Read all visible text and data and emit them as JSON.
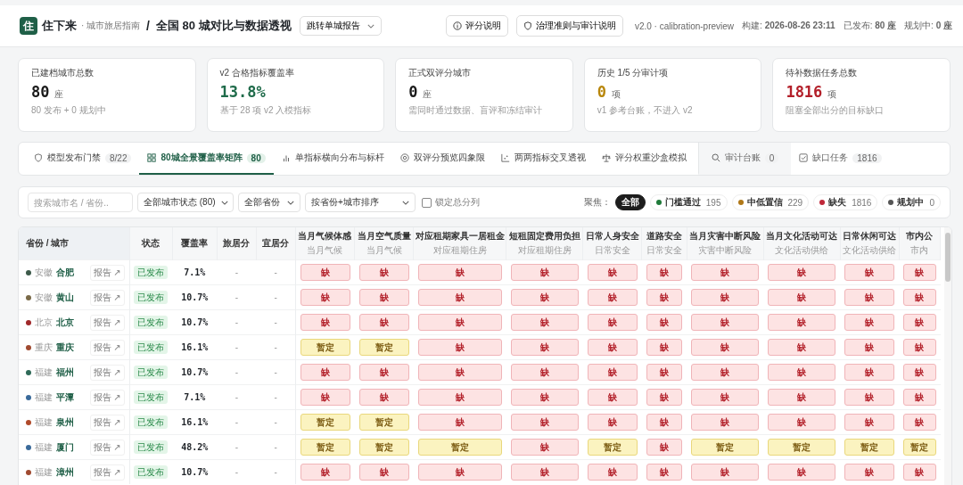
{
  "header": {
    "logo": "住",
    "brand": "住下来",
    "brand_sub": "· 城市旅居指南",
    "separator": "/",
    "title": "全国 80 城对比与数据透视",
    "jump_select": "跳转单城报告",
    "buttons": [
      {
        "label": "评分说明",
        "kind": "info"
      },
      {
        "label": "治理准则与审计说明",
        "kind": "shield"
      }
    ],
    "version": "v2.0 · calibration-preview",
    "build": "构建: **2026-08-26 23:11**",
    "published": "已发布: **80 座**",
    "planned": "规划中: **0 座**"
  },
  "stats": [
    {
      "label": "已建档城市总数",
      "value": "80",
      "unit": "座",
      "note": "80 发布 + 0 规划中",
      "color": "#1a1a1a"
    },
    {
      "label": "v2 合格指标覆盖率",
      "value": "13.8%",
      "note": "基于 28 项 v2 入模指标",
      "color": "#1f6b4a"
    },
    {
      "label": "正式双评分城市",
      "value": "0",
      "unit": "座",
      "note": "需同时通过数据、盲评和冻结审计",
      "color": "#1a1a1a"
    },
    {
      "label": "历史 1/5 分审计项",
      "value": "0",
      "unit": "项",
      "note": "v1 参考台账，不进入 v2",
      "color": "#b8860b"
    },
    {
      "label": "待补数据任务总数",
      "value": "1816",
      "unit": "项",
      "note": "阻塞全部出分的目标缺口",
      "color": "#b3202a"
    }
  ],
  "tabs": [
    {
      "label": "模型发布门禁",
      "count": "8/22",
      "kind": "main",
      "selected": false
    },
    {
      "label": "80城全景覆盖率矩阵",
      "count": "80",
      "kind": "main",
      "selected": true
    },
    {
      "label": "单指标横向分布与标杆",
      "kind": "main",
      "selected": false
    },
    {
      "label": "双评分预览四象限",
      "kind": "main",
      "selected": false
    },
    {
      "label": "两两指标交叉透视",
      "kind": "main",
      "selected": false
    },
    {
      "label": "评分权重沙盒模拟",
      "kind": "main",
      "selected": false
    },
    {
      "label": "审计台账",
      "count": "0",
      "kind": "aux",
      "selected": false
    },
    {
      "label": "缺口任务",
      "count": "1816",
      "kind": "aux",
      "selected": false
    }
  ],
  "filters": {
    "search": {
      "placeholder": "搜索城市名 / 省份.."
    },
    "selects": [
      "全部城市状态 (80)",
      "全部省份",
      "按省份+城市排序"
    ],
    "lock": {
      "label": "锁定总分列",
      "checked": false
    },
    "focus_label": "聚焦：",
    "focus": [
      {
        "label": "全部",
        "selected": true
      },
      {
        "label": "门槛通过",
        "count": "195",
        "color": "#1f7a3a",
        "selected": false
      },
      {
        "label": "中低置信",
        "count": "229",
        "color": "#b07818",
        "selected": false
      },
      {
        "label": "缺失",
        "count": "1816",
        "color": "#c0283a",
        "selected": false
      },
      {
        "label": "规划中",
        "count": "0",
        "color": "#555555",
        "selected": false
      }
    ]
  },
  "table": {
    "columns": [
      "省份 / 城市",
      "状态",
      "覆盖率",
      "旅居分",
      "宜居分"
    ],
    "metrics": [
      {
        "title": "当月气候体感",
        "sub": "当月气候"
      },
      {
        "title": "当月空气质量",
        "sub": "当月气候"
      },
      {
        "title": "对应租期家具一居租金",
        "sub": "对应租期住房"
      },
      {
        "title": "短租固定费用负担",
        "sub": "对应租期住房"
      },
      {
        "title": "日常人身安全",
        "sub": "日常安全"
      },
      {
        "title": "道路安全",
        "sub": "日常安全"
      },
      {
        "title": "当月灾害中断风险",
        "sub": "灾害中断风险"
      },
      {
        "title": "当月文化活动可达",
        "sub": "文化活动供给"
      },
      {
        "title": "日常休闲可达",
        "sub": "文化活动供给"
      },
      {
        "title": "市内公",
        "sub": "市内"
      }
    ],
    "rows": [
      {
        "province": "安徽",
        "city": "合肥",
        "color": "#3d5a4a",
        "report": "报告 ↗",
        "status": "已发布",
        "coverage": "7.1%",
        "travel": "-",
        "live": "-",
        "cells": [
          {
            "kind": "missing",
            "text": "缺"
          },
          {
            "kind": "missing",
            "text": "缺"
          },
          {
            "kind": "missing",
            "text": "缺"
          },
          {
            "kind": "missing",
            "text": "缺"
          },
          {
            "kind": "missing",
            "text": "缺"
          },
          {
            "kind": "missing",
            "text": "缺"
          },
          {
            "kind": "missing",
            "text": "缺"
          },
          {
            "kind": "missing",
            "text": "缺"
          },
          {
            "kind": "missing",
            "text": "缺"
          },
          {
            "kind": "missing",
            "text": "缺"
          }
        ]
      },
      {
        "province": "安徽",
        "city": "黄山",
        "color": "#7a6a48",
        "report": "报告 ↗",
        "status": "已发布",
        "coverage": "10.7%",
        "travel": "-",
        "live": "-",
        "cells": [
          {
            "kind": "missing",
            "text": "缺"
          },
          {
            "kind": "missing",
            "text": "缺"
          },
          {
            "kind": "missing",
            "text": "缺"
          },
          {
            "kind": "missing",
            "text": "缺"
          },
          {
            "kind": "missing",
            "text": "缺"
          },
          {
            "kind": "missing",
            "text": "缺"
          },
          {
            "kind": "missing",
            "text": "缺"
          },
          {
            "kind": "missing",
            "text": "缺"
          },
          {
            "kind": "missing",
            "text": "缺"
          },
          {
            "kind": "missing",
            "text": "缺"
          }
        ]
      },
      {
        "province": "北京",
        "city": "北京",
        "color": "#a0282a",
        "report": "报告 ↗",
        "status": "已发布",
        "coverage": "10.7%",
        "travel": "-",
        "live": "-",
        "cells": [
          {
            "kind": "missing",
            "text": "缺"
          },
          {
            "kind": "missing",
            "text": "缺"
          },
          {
            "kind": "missing",
            "text": "缺"
          },
          {
            "kind": "missing",
            "text": "缺"
          },
          {
            "kind": "missing",
            "text": "缺"
          },
          {
            "kind": "missing",
            "text": "缺"
          },
          {
            "kind": "missing",
            "text": "缺"
          },
          {
            "kind": "missing",
            "text": "缺"
          },
          {
            "kind": "missing",
            "text": "缺"
          },
          {
            "kind": "missing",
            "text": "缺"
          }
        ]
      },
      {
        "province": "重庆",
        "city": "重庆",
        "color": "#a04a30",
        "report": "报告 ↗",
        "status": "已发布",
        "coverage": "16.1%",
        "travel": "-",
        "live": "-",
        "cells": [
          {
            "kind": "tentative",
            "text": "暂定"
          },
          {
            "kind": "tentative",
            "text": "暂定"
          },
          {
            "kind": "missing",
            "text": "缺"
          },
          {
            "kind": "missing",
            "text": "缺"
          },
          {
            "kind": "missing",
            "text": "缺"
          },
          {
            "kind": "missing",
            "text": "缺"
          },
          {
            "kind": "missing",
            "text": "缺"
          },
          {
            "kind": "missing",
            "text": "缺"
          },
          {
            "kind": "missing",
            "text": "缺"
          },
          {
            "kind": "missing",
            "text": "缺"
          }
        ]
      },
      {
        "province": "福建",
        "city": "福州",
        "color": "#2f6a58",
        "report": "报告 ↗",
        "status": "已发布",
        "coverage": "10.7%",
        "travel": "-",
        "live": "-",
        "cells": [
          {
            "kind": "missing",
            "text": "缺"
          },
          {
            "kind": "missing",
            "text": "缺"
          },
          {
            "kind": "missing",
            "text": "缺"
          },
          {
            "kind": "missing",
            "text": "缺"
          },
          {
            "kind": "missing",
            "text": "缺"
          },
          {
            "kind": "missing",
            "text": "缺"
          },
          {
            "kind": "missing",
            "text": "缺"
          },
          {
            "kind": "missing",
            "text": "缺"
          },
          {
            "kind": "missing",
            "text": "缺"
          },
          {
            "kind": "missing",
            "text": "缺"
          }
        ]
      },
      {
        "province": "福建",
        "city": "平潭",
        "color": "#3a6a9a",
        "report": "报告 ↗",
        "status": "已发布",
        "coverage": "7.1%",
        "travel": "-",
        "live": "-",
        "cells": [
          {
            "kind": "missing",
            "text": "缺"
          },
          {
            "kind": "missing",
            "text": "缺"
          },
          {
            "kind": "missing",
            "text": "缺"
          },
          {
            "kind": "missing",
            "text": "缺"
          },
          {
            "kind": "missing",
            "text": "缺"
          },
          {
            "kind": "missing",
            "text": "缺"
          },
          {
            "kind": "missing",
            "text": "缺"
          },
          {
            "kind": "missing",
            "text": "缺"
          },
          {
            "kind": "missing",
            "text": "缺"
          },
          {
            "kind": "missing",
            "text": "缺"
          }
        ]
      },
      {
        "province": "福建",
        "city": "泉州",
        "color": "#b04a2a",
        "report": "报告 ↗",
        "status": "已发布",
        "coverage": "16.1%",
        "travel": "-",
        "live": "-",
        "cells": [
          {
            "kind": "tentative",
            "text": "暂定"
          },
          {
            "kind": "tentative",
            "text": "暂定"
          },
          {
            "kind": "missing",
            "text": "缺"
          },
          {
            "kind": "missing",
            "text": "缺"
          },
          {
            "kind": "missing",
            "text": "缺"
          },
          {
            "kind": "missing",
            "text": "缺"
          },
          {
            "kind": "missing",
            "text": "缺"
          },
          {
            "kind": "missing",
            "text": "缺"
          },
          {
            "kind": "missing",
            "text": "缺"
          },
          {
            "kind": "missing",
            "text": "缺"
          }
        ]
      },
      {
        "province": "福建",
        "city": "厦门",
        "color": "#3a6a9a",
        "report": "报告 ↗",
        "status": "已发布",
        "coverage": "48.2%",
        "travel": "-",
        "live": "-",
        "cells": [
          {
            "kind": "tentative",
            "text": "暂定"
          },
          {
            "kind": "tentative",
            "text": "暂定"
          },
          {
            "kind": "tentative",
            "text": "暂定"
          },
          {
            "kind": "missing",
            "text": "缺"
          },
          {
            "kind": "tentative",
            "text": "暂定"
          },
          {
            "kind": "missing",
            "text": "缺"
          },
          {
            "kind": "tentative",
            "text": "暂定"
          },
          {
            "kind": "tentative",
            "text": "暂定"
          },
          {
            "kind": "tentative",
            "text": "暂定"
          },
          {
            "kind": "tentative",
            "text": "暂定"
          }
        ]
      },
      {
        "province": "福建",
        "city": "漳州",
        "color": "#a04a30",
        "report": "报告 ↗",
        "status": "已发布",
        "coverage": "10.7%",
        "travel": "-",
        "live": "-",
        "cells": [
          {
            "kind": "missing",
            "text": "缺"
          },
          {
            "kind": "missing",
            "text": "缺"
          },
          {
            "kind": "missing",
            "text": "缺"
          },
          {
            "kind": "missing",
            "text": "缺"
          },
          {
            "kind": "missing",
            "text": "缺"
          },
          {
            "kind": "missing",
            "text": "缺"
          },
          {
            "kind": "missing",
            "text": "缺"
          },
          {
            "kind": "missing",
            "text": "缺"
          },
          {
            "kind": "missing",
            "text": "缺"
          },
          {
            "kind": "missing",
            "text": "缺"
          }
        ]
      }
    ]
  }
}
